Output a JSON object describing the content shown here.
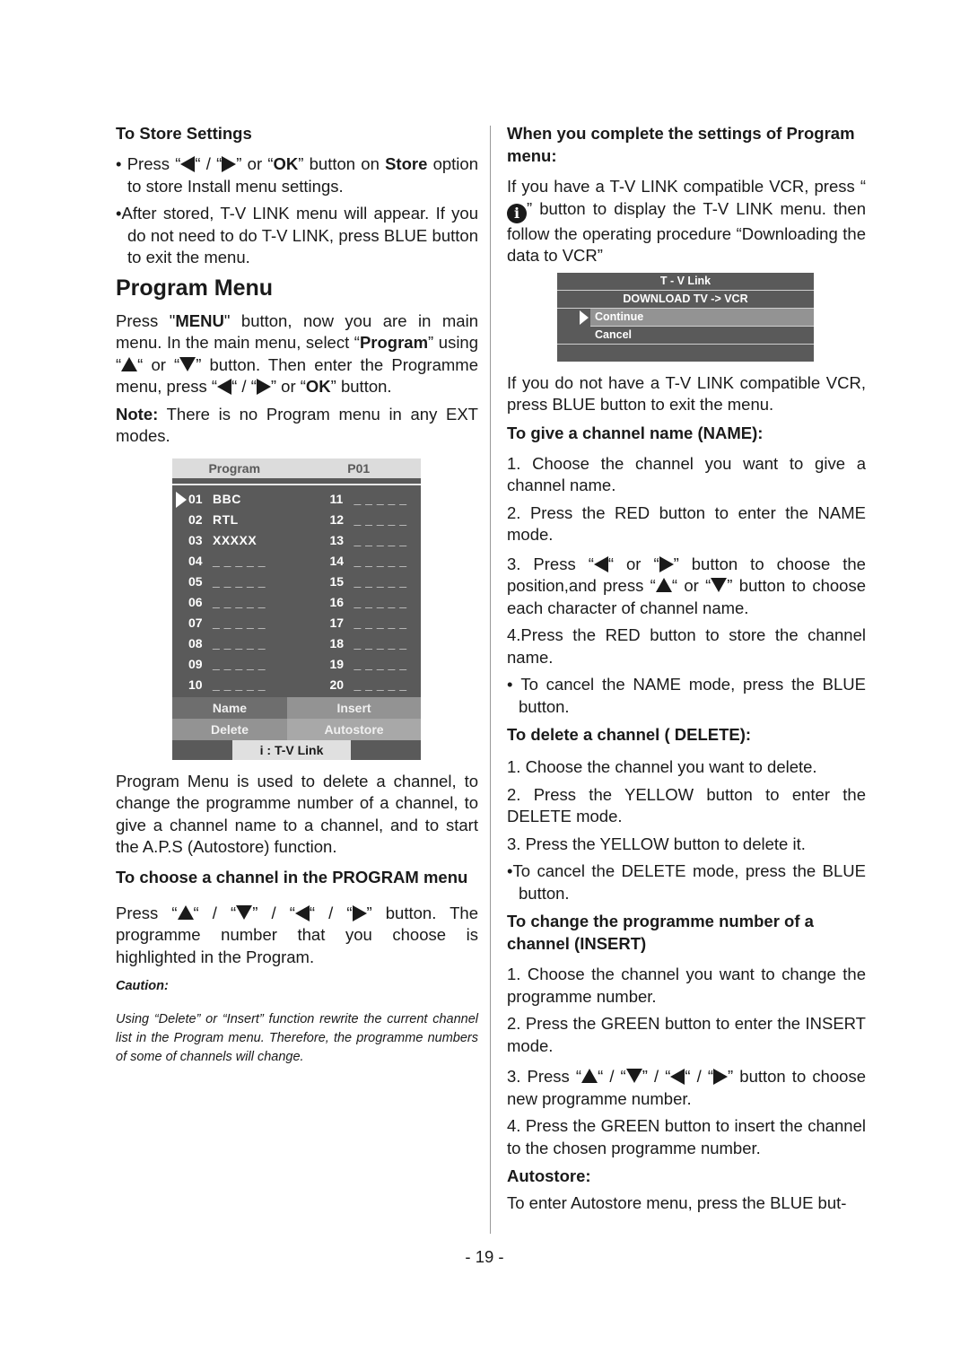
{
  "page_number": "- 19 -",
  "left": {
    "store_heading": "To Store Settings",
    "store_b1": {
      "pre": "Press “",
      "mid1": "“ / “",
      "mid2": "” or “",
      "ok": "OK",
      "mid3": "” button on ",
      "store": "Store",
      "post": " option to store Install menu settings."
    },
    "store_b2": "After stored, T-V LINK menu will appear. If you do not need to do T-V LINK, press BLUE button to exit the menu.",
    "title": "Program Menu",
    "intro": {
      "pre": "Press \"",
      "menu": "MENU",
      "mid1": "\" button, now you are in main menu. In the main menu, select “",
      "program": "Program",
      "mid2": "” using “",
      "mid3": "“ or “",
      "mid4": "” button. Then enter the Programme menu, press “",
      "mid5": "“ / “",
      "mid6": "” or “",
      "ok": "OK",
      "post": "” button."
    },
    "note_label": "Note:",
    "note_text": " There is no Program menu in any EXT modes.",
    "osd": {
      "header_left": "Program",
      "header_right": "P01",
      "rows": [
        {
          "l_num": "01",
          "l_name": "BBC",
          "r_num": "11",
          "r_name": "_ _ _ _ _",
          "selected": true
        },
        {
          "l_num": "02",
          "l_name": "RTL",
          "r_num": "12",
          "r_name": "_ _ _ _ _"
        },
        {
          "l_num": "03",
          "l_name": "XXXXX",
          "r_num": "13",
          "r_name": "_ _ _ _ _"
        },
        {
          "l_num": "04",
          "l_name": "_ _ _ _ _",
          "r_num": "14",
          "r_name": "_ _ _ _ _"
        },
        {
          "l_num": "05",
          "l_name": "_ _ _ _ _",
          "r_num": "15",
          "r_name": "_ _ _ _ _"
        },
        {
          "l_num": "06",
          "l_name": "_ _ _ _ _",
          "r_num": "16",
          "r_name": "_ _ _ _ _"
        },
        {
          "l_num": "07",
          "l_name": "_ _ _ _ _",
          "r_num": "17",
          "r_name": "_ _ _ _ _"
        },
        {
          "l_num": "08",
          "l_name": "_ _ _ _ _",
          "r_num": "18",
          "r_name": "_ _ _ _ _"
        },
        {
          "l_num": "09",
          "l_name": "_ _ _ _ _",
          "r_num": "19",
          "r_name": "_ _ _ _ _"
        },
        {
          "l_num": "10",
          "l_name": "_ _ _ _ _",
          "r_num": "20",
          "r_name": "_ _ _ _ _"
        }
      ],
      "btn_name": "Name",
      "btn_insert": "Insert",
      "btn_delete": "Delete",
      "btn_autostore": "Autostore",
      "footer": "i :  T-V  Link"
    },
    "usage": "Program Menu is used to delete a channel, to change the programme number of a channel, to give a channel name to a channel, and to start the A.P.S (Autostore) function.",
    "choose_heading": "To choose a channel in the PROGRAM menu",
    "choose_text": {
      "pre": " Press “",
      "s1": "“ /  “",
      "s2": "” / “",
      "s3": "“ /  “",
      "post": "” button. The programme number that you choose is highlighted in the Program."
    },
    "caution_label": "Caution:",
    "caution_text": "Using “Delete” or “Insert” function rewrite the current channel list in the Program menu. Therefore, the programme numbers of some of channels will change."
  },
  "right": {
    "complete_heading": "When you complete the settings of Program menu:",
    "complete_text": {
      "pre": "If you have a T-V LINK compatible VCR, press “",
      "post": "” button to display the T-V LINK menu. then follow the operating procedure “Downloading the data to VCR”"
    },
    "tvlink": {
      "title": "T - V Link",
      "subtitle": "DOWNLOAD TV -> VCR",
      "options": [
        "Continue",
        "Cancel"
      ],
      "selected": "Continue"
    },
    "no_tvlink": "If you do not have a T-V LINK compatible VCR, press BLUE button to exit the menu.",
    "name_heading": "To give a channel name (NAME):",
    "name_steps": [
      "1. Choose the channel you want to give a channel name.",
      "2. Press the RED button to enter the NAME mode."
    ],
    "name_step3": {
      "pre": "3. Press “",
      "s1": "“ or “",
      "s2": "” button to choose the position,and press “",
      "s3": "“ or “",
      "post": "” button to choose each character of channel name."
    },
    "name_step4": "4.Press the RED button to store the channel name.",
    "name_cancel": "To cancel the NAME mode, press the BLUE button.",
    "delete_heading": "To delete a channel ( DELETE):",
    "delete_steps": [
      "1. Choose the channel you want to delete.",
      "2. Press the YELLOW button to enter the DELETE  mode.",
      "3. Press the YELLOW button to delete it."
    ],
    "delete_cancel": "To cancel the DELETE mode, press the BLUE button.",
    "insert_heading": "To change the programme number of a channel (INSERT)",
    "insert_steps": [
      "1. Choose the channel you want to change the programme number.",
      "2. Press the GREEN button to enter the INSERT  mode."
    ],
    "insert_step3": {
      "pre": "3.  Press “",
      "s1": "“ /  “",
      "s2": "” / “",
      "s3": "“ /  “",
      "post": "” button to choose new programme number."
    },
    "insert_step4": "4. Press the GREEN button to insert the channel to the chosen programme number.",
    "autostore_heading": "Autostore:",
    "autostore_text": "To enter Autostore menu, press the BLUE but-"
  }
}
